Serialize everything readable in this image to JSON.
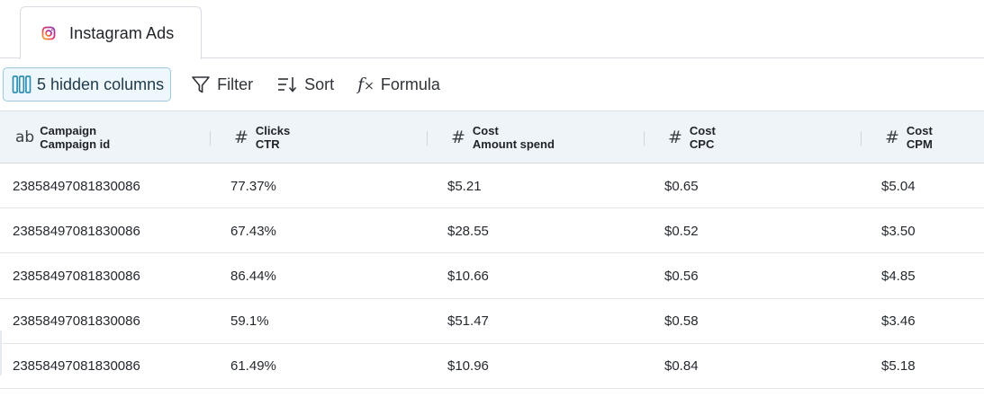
{
  "tab": {
    "label": "Instagram Ads",
    "icon": "instagram-icon"
  },
  "toolbar": {
    "hidden_columns_label": "5 hidden columns",
    "filter_label": "Filter",
    "sort_label": "Sort",
    "formula_label": "Formula"
  },
  "table": {
    "columns": [
      {
        "type": "ab",
        "group": "Campaign",
        "field": "Campaign id"
      },
      {
        "type": "#",
        "group": "Clicks",
        "field": "CTR"
      },
      {
        "type": "#",
        "group": "Cost",
        "field": "Amount spend"
      },
      {
        "type": "#",
        "group": "Cost",
        "field": "CPC"
      },
      {
        "type": "#",
        "group": "Cost",
        "field": "CPM"
      }
    ],
    "rows": [
      [
        "23858497081830086",
        "77.37%",
        "$5.21",
        "$0.65",
        "$5.04"
      ],
      [
        "23858497081830086",
        "67.43%",
        "$28.55",
        "$0.52",
        "$3.50"
      ],
      [
        "23858497081830086",
        "86.44%",
        "$10.66",
        "$0.56",
        "$4.85"
      ],
      [
        "23858497081830086",
        "59.1%",
        "$51.47",
        "$0.58",
        "$3.46"
      ],
      [
        "23858497081830086",
        "61.49%",
        "$10.96",
        "$0.84",
        "$5.18"
      ]
    ]
  },
  "colors": {
    "accent": "#2f8fb3",
    "header_bg": "#eef4f8",
    "chip_bg": "#eef7fb",
    "chip_border": "#9cc9db",
    "border": "#d9dde3"
  }
}
